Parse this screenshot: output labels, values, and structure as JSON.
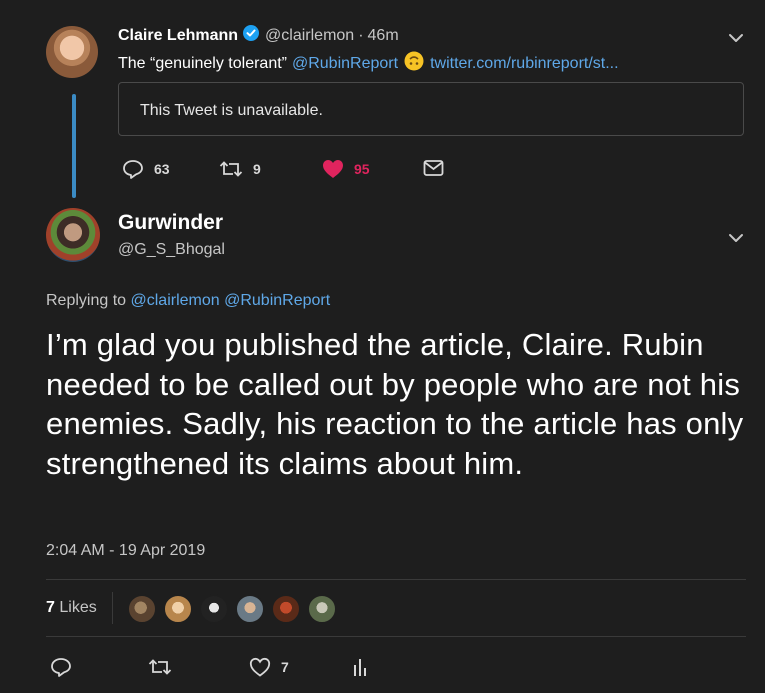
{
  "parent_tweet": {
    "author_name": "Claire Lehmann",
    "handle": "@clairlemon",
    "separator": "·",
    "time": "46m",
    "text_prefix": "The “genuinely tolerant”",
    "mention": "@RubinReport",
    "emoji": "upside-down-face",
    "link_text": "twitter.com/rubinreport/st...",
    "quoted_unavailable": "This Tweet is unavailable.",
    "actions": {
      "replies": "63",
      "retweets": "9",
      "likes": "95"
    }
  },
  "main_tweet": {
    "author_name": "Gurwinder",
    "handle": "@G_S_Bhogal",
    "replying_label": "Replying to",
    "replying_to": [
      "@clairlemon",
      "@RubinReport"
    ],
    "text": "I’m glad you published the article, Claire. Rubin needed to be called out by people who are not his enemies. Sadly, his reaction to the article has only strengthened its claims about him.",
    "timestamp": "2:04 AM - 19 Apr 2019",
    "likes_count": "7",
    "likes_label": "Likes",
    "actions": {
      "likes": "7"
    }
  },
  "colors": {
    "background": "#1e1e1e",
    "link": "#5fa8e8",
    "like_active": "#e0245e",
    "thread_line": "#3b8bc4",
    "verified": "#1da1f2"
  },
  "icons": [
    "verified-badge-icon",
    "chevron-down-icon",
    "reply-icon",
    "retweet-icon",
    "heart-icon",
    "message-icon",
    "analytics-icon"
  ]
}
